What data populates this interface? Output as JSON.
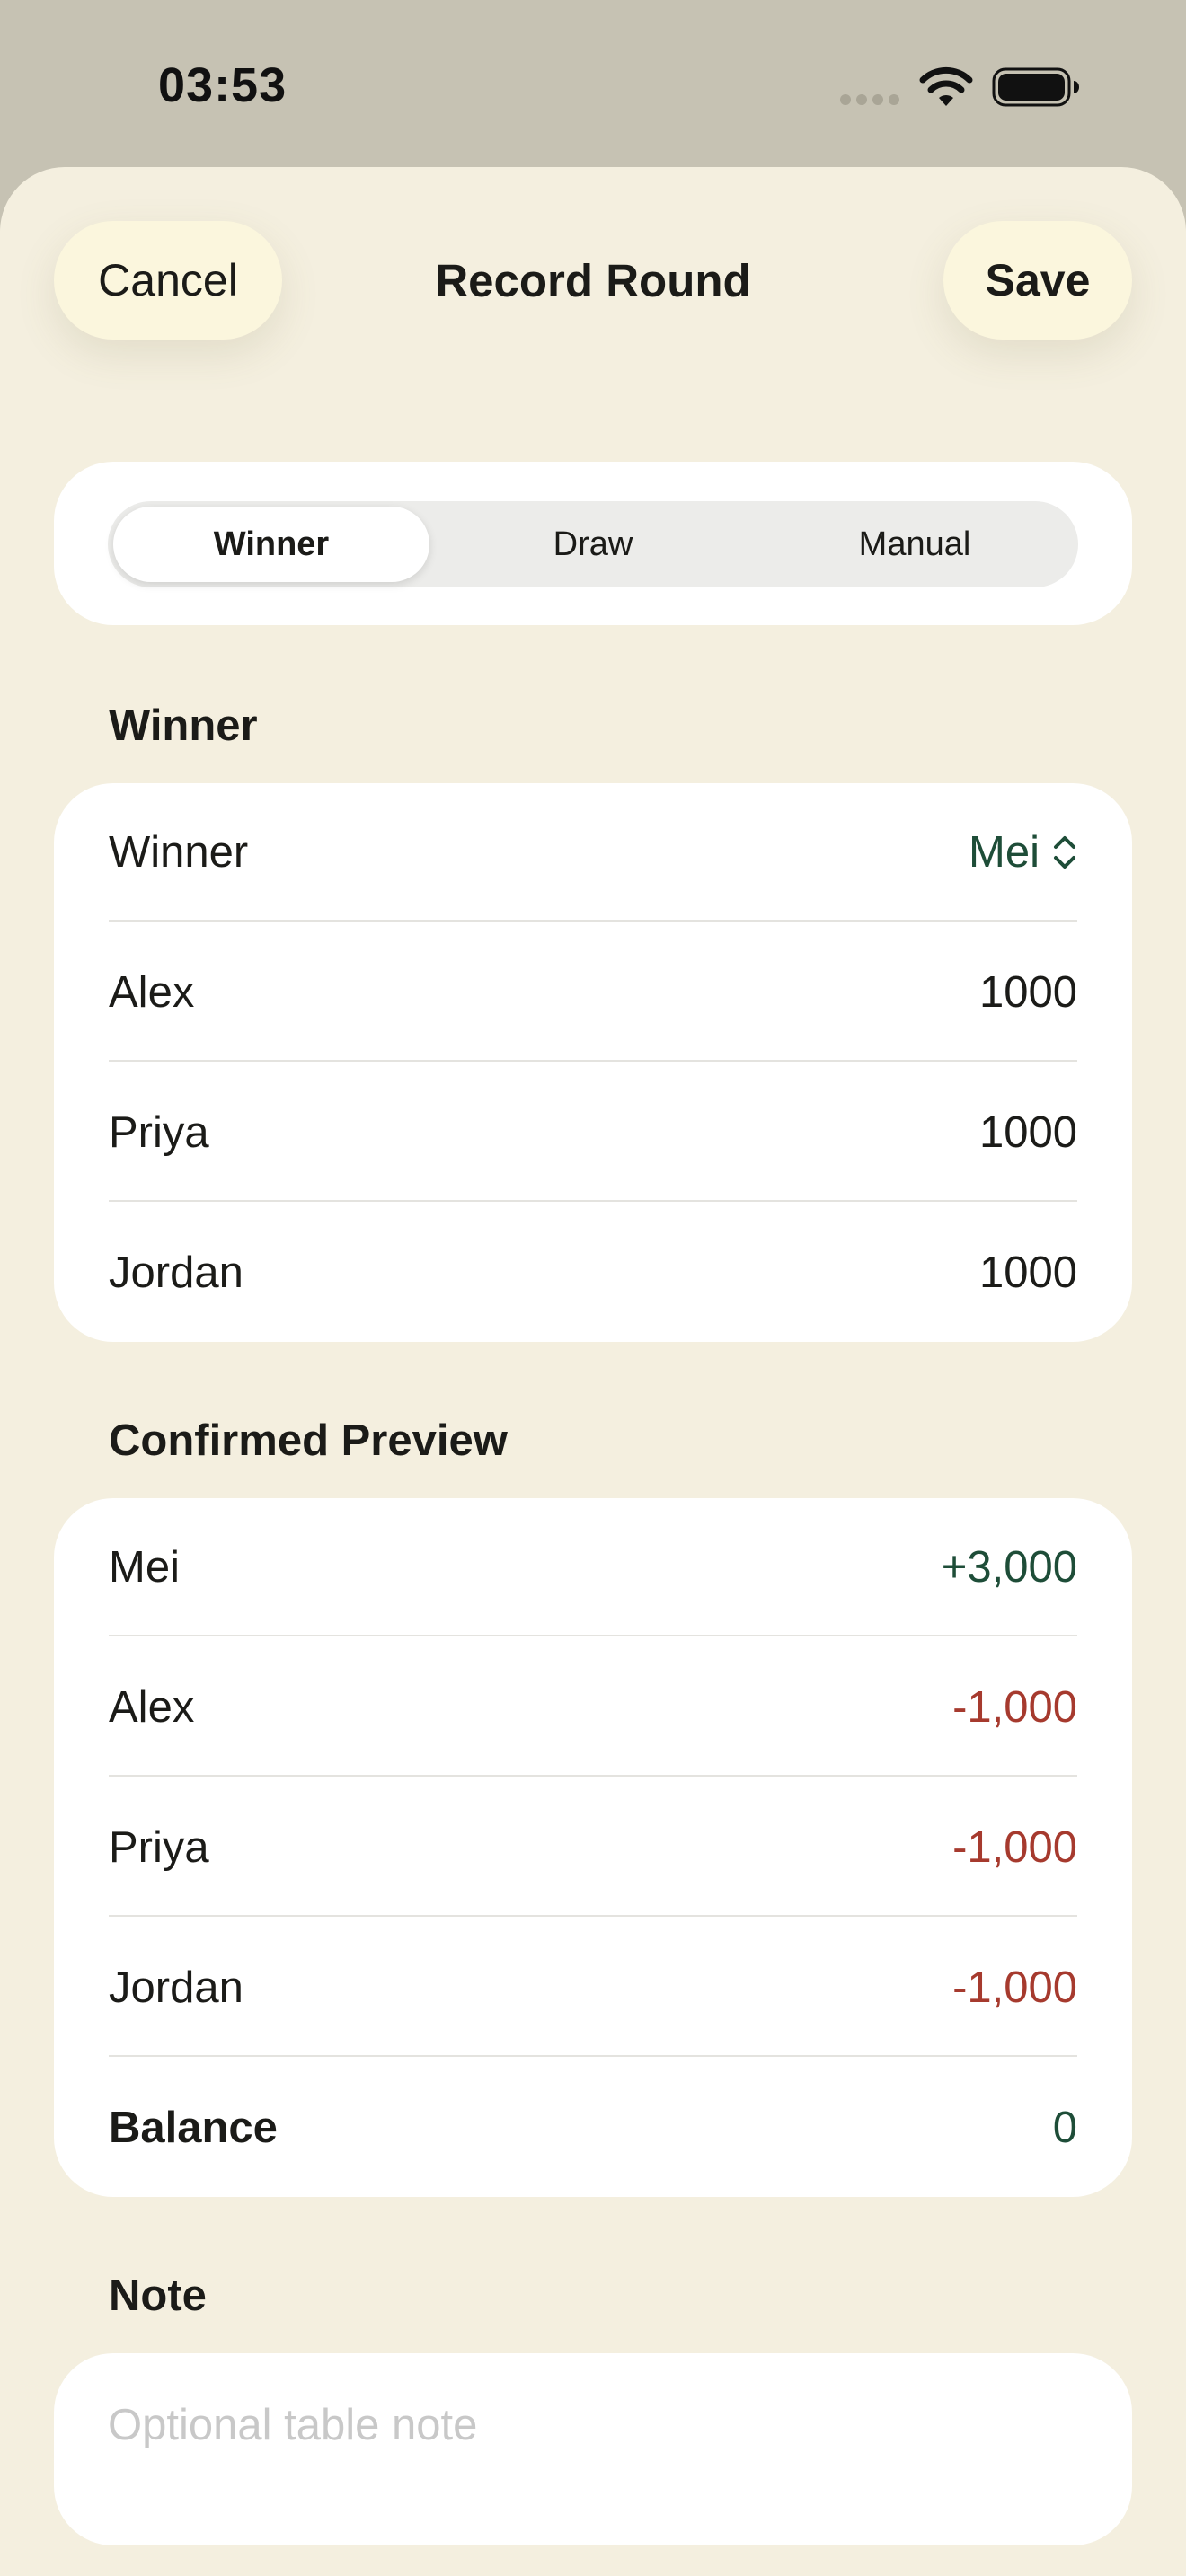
{
  "status_bar": {
    "time": "03:53"
  },
  "header": {
    "cancel_label": "Cancel",
    "title": "Record Round",
    "save_label": "Save"
  },
  "mode_selector": {
    "options": [
      "Winner",
      "Draw",
      "Manual"
    ],
    "selected": "Winner"
  },
  "winner_section": {
    "header": "Winner",
    "picker_label": "Winner",
    "picker_value": "Mei",
    "rows": [
      {
        "name": "Alex",
        "value": "1000"
      },
      {
        "name": "Priya",
        "value": "1000"
      },
      {
        "name": "Jordan",
        "value": "1000"
      }
    ]
  },
  "preview_section": {
    "header": "Confirmed Preview",
    "rows": [
      {
        "name": "Mei",
        "value": "+3,000"
      },
      {
        "name": "Alex",
        "value": "-1,000"
      },
      {
        "name": "Priya",
        "value": "-1,000"
      },
      {
        "name": "Jordan",
        "value": "-1,000"
      }
    ],
    "balance_label": "Balance",
    "balance_value": "0"
  },
  "note_section": {
    "header": "Note",
    "value": "",
    "placeholder": "Optional table note"
  },
  "colors": {
    "positive": "#1e4d38",
    "negative": "#a63a2e",
    "sheet_background": "#f4efdf",
    "button_background": "#fbf6dd"
  }
}
